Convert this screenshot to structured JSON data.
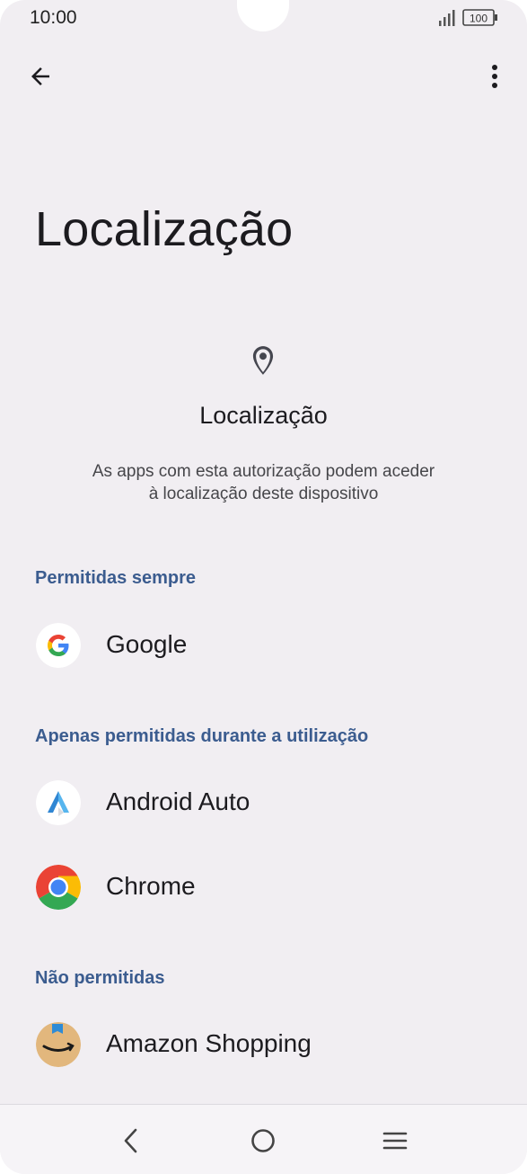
{
  "status_bar": {
    "time": "10:00",
    "battery": "100"
  },
  "title": "Localização",
  "header": {
    "icon": "location-pin-icon",
    "title": "Localização",
    "description_line1": "As apps com esta autorização podem aceder",
    "description_line2": "à localização deste dispositivo"
  },
  "sections": [
    {
      "label": "Permitidas sempre",
      "apps": [
        {
          "name": "Google",
          "icon": "google-icon"
        }
      ]
    },
    {
      "label": "Apenas permitidas durante a utilização",
      "apps": [
        {
          "name": "Android Auto",
          "icon": "android-auto-icon"
        },
        {
          "name": "Chrome",
          "icon": "chrome-icon"
        }
      ]
    },
    {
      "label": "Não permitidas",
      "apps": [
        {
          "name": "Amazon Shopping",
          "icon": "amazon-shopping-icon"
        }
      ]
    }
  ],
  "colors": {
    "background": "#f1eef2",
    "category": "#3b5c8f",
    "text": "#1c1b1f"
  }
}
